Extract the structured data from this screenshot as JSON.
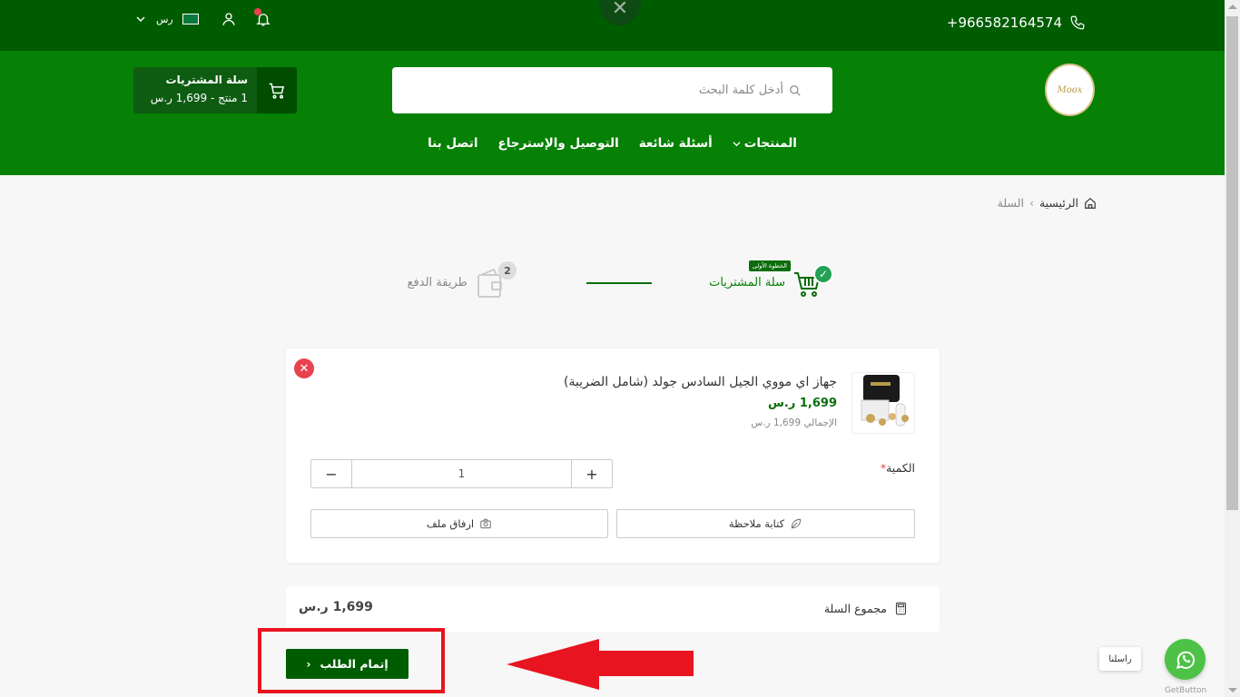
{
  "topbar": {
    "phone": "+966582164574",
    "currency": "رس",
    "icons": [
      "phone-icon",
      "bell-icon",
      "user-icon",
      "flag-icon",
      "chevron-down-icon",
      "close-icon"
    ]
  },
  "header": {
    "logo_text": "Moox",
    "search_placeholder": "أدخل كلمة البحث",
    "cart_title": "سلة المشتريات",
    "cart_summary": "1 منتج - 1,699 ر.س"
  },
  "nav": {
    "items": [
      "المنتجات",
      "أسئلة شائعة",
      "التوصيل والإسترجاع",
      "اتصل بنا"
    ]
  },
  "breadcrumb": {
    "home": "الرئيسية",
    "current": "السلة"
  },
  "steps": {
    "step1_label": "سلة المشتريات",
    "step1_badge": "الخطوة الأولى",
    "step2_label": "طريقة الدفع",
    "step2_number": "2"
  },
  "product": {
    "name": "جهاز اي مووي الجيل السادس جولد (شامل الضريبة)",
    "price": "1,699 ر.س",
    "total": "الإجمالي 1,699 ر.س",
    "quantity_label": "الكمية",
    "quantity_required": "*",
    "quantity_value": "1",
    "minus": "−",
    "plus": "+",
    "note_button": "كتابة ملاحظة",
    "attach_button": "ارفاق ملف"
  },
  "summary": {
    "label": "مجموع السلة",
    "value": "1,699 ر.س"
  },
  "checkout": {
    "label": "إتمام الطلب",
    "arrow": "‹"
  },
  "whatsapp": {
    "bubble": "راسلنا",
    "caption": "GetButton"
  },
  "colors": {
    "topbar": "#005c00",
    "header": "#068005",
    "accent": "#0b6d0b",
    "danger": "#e8424f",
    "annotation_red": "#e8141f",
    "whatsapp": "#4dc247"
  }
}
